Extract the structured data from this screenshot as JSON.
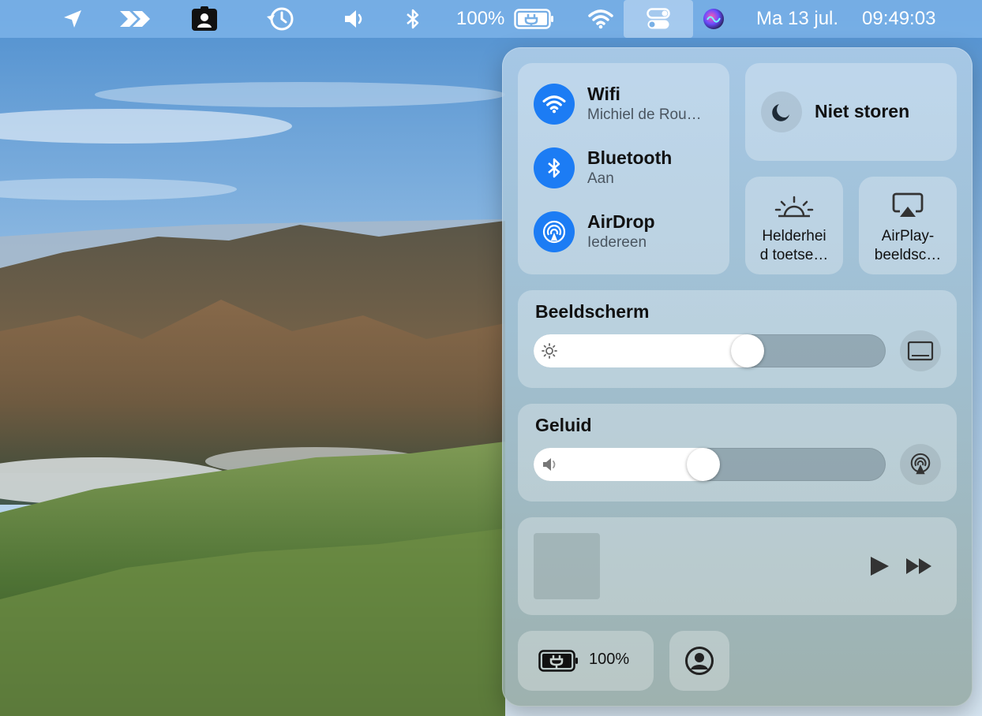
{
  "menubar": {
    "icons": [
      "location-arrow-icon",
      "double-chevron-icon",
      "user-badge-icon",
      "time-machine-icon",
      "speaker-icon",
      "bluetooth-icon",
      "battery-icon",
      "wifi-icon",
      "control-center-icon",
      "siri-icon"
    ],
    "battery_percent": "100%",
    "date": "Ma 13 jul.",
    "time": "09:49:03"
  },
  "control_center": {
    "wifi": {
      "title": "Wifi",
      "subtitle": "Michiel de Rou…",
      "icon": "wifi-icon"
    },
    "bluetooth": {
      "title": "Bluetooth",
      "subtitle": "Aan",
      "icon": "bluetooth-icon"
    },
    "airdrop": {
      "title": "AirDrop",
      "subtitle": "Iedereen",
      "icon": "airdrop-icon"
    },
    "dnd": {
      "label": "Niet storen",
      "icon": "moon-icon"
    },
    "keyboard_brightness": {
      "label_line1": "Helderhei",
      "label_line2": "d toetse…",
      "icon": "keyboard-brightness-icon"
    },
    "airplay": {
      "label_line1": "AirPlay-",
      "label_line2": "beeldsc…",
      "icon": "airplay-icon"
    },
    "display": {
      "title": "Beeldscherm",
      "level": 0.62,
      "icon": "sun-icon",
      "side_icon": "display-icon"
    },
    "sound": {
      "title": "Geluid",
      "level": 0.48,
      "icon": "speaker-icon",
      "side_icon": "airplay-audio-icon"
    },
    "now_playing": {
      "play_icon": "play-icon",
      "forward_icon": "fast-forward-icon"
    },
    "battery": {
      "label": "100%",
      "icon": "battery-charging-icon"
    },
    "user": {
      "icon": "user-icon"
    }
  },
  "colors": {
    "accent": "#1c7cf4",
    "menubar": "#78b0e6"
  }
}
